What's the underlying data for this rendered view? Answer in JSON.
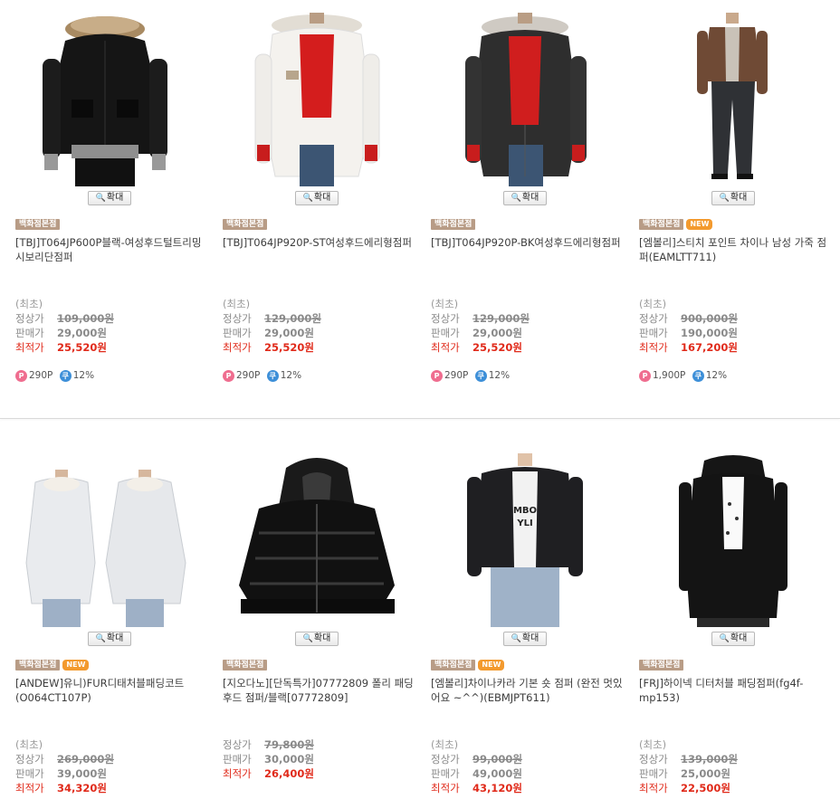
{
  "zoom_label": "확대",
  "price_labels": {
    "min": "(최초)",
    "list": "정상가",
    "sale": "판매가",
    "best": "최적가"
  },
  "badges": {
    "dept": "백화점본점",
    "new": "NEW"
  },
  "products": [
    {
      "title": "[TBJ]T064JP600P블랙-여성후드털트리밍시보리단점퍼",
      "list_price": "109,000원",
      "sale_price": "29,000원",
      "best_price": "25,520원",
      "points": "290P",
      "coupon": "12%",
      "is_new": false
    },
    {
      "title": "[TBJ]T064JP920P-ST여성후드에리형점퍼",
      "list_price": "129,000원",
      "sale_price": "29,000원",
      "best_price": "25,520원",
      "points": "290P",
      "coupon": "12%",
      "is_new": false
    },
    {
      "title": "[TBJ]T064JP920P-BK여성후드에리형점퍼",
      "list_price": "129,000원",
      "sale_price": "29,000원",
      "best_price": "25,520원",
      "points": "290P",
      "coupon": "12%",
      "is_new": false
    },
    {
      "title": "[엠볼리]스티치 포인트 차이나 남성 가죽 점퍼(EAMLTT711)",
      "list_price": "900,000원",
      "sale_price": "190,000원",
      "best_price": "167,200원",
      "points": "1,900P",
      "coupon": "12%",
      "is_new": true
    },
    {
      "title": "[ANDEW]유니)FUR디태처블패딩코트(O064CT107P)",
      "list_price": "269,000원",
      "sale_price": "39,000원",
      "best_price": "34,320원",
      "is_new": true
    },
    {
      "title": "[지오다노][단독특가]07772809 폴리 패딩 후드 점퍼/블랙[07772809]",
      "list_price": "79,800원",
      "sale_price": "30,000원",
      "best_price": "26,400원",
      "is_new": false
    },
    {
      "title": "[엠볼리]차이나카라 기본 숏 점퍼 (완전 멋있어요 ~^^)(EBMJPT611)",
      "list_price": "99,000원",
      "sale_price": "49,000원",
      "best_price": "43,120원",
      "is_new": true
    },
    {
      "title": "[FRJ]하이넥 디터처블 패딩점퍼(fg4f-mp153)",
      "list_price": "139,000원",
      "sale_price": "25,000원",
      "best_price": "22,500원",
      "is_new": false
    }
  ]
}
